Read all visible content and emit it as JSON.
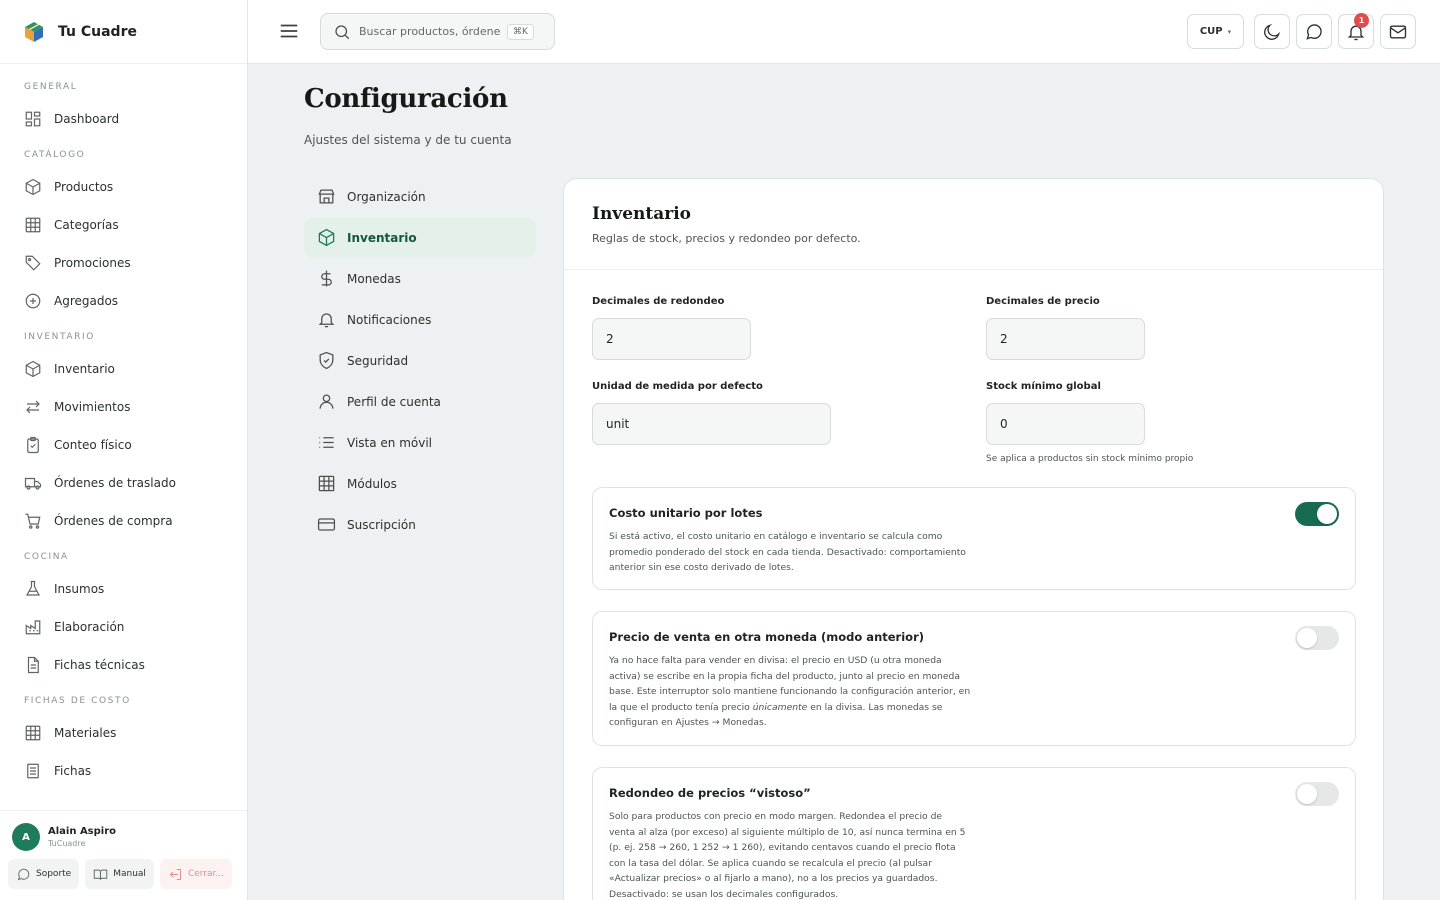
{
  "app": {
    "name": "Tu Cuadre"
  },
  "colors": {
    "accent": "#176b50",
    "active_bg": "#e4f0ea",
    "badge": "#e24b4b"
  },
  "sidebar": {
    "sections": [
      {
        "label": "GENERAL",
        "items": [
          {
            "label": "Dashboard",
            "icon": "dashboard-icon"
          }
        ]
      },
      {
        "label": "CATÁLOGO",
        "items": [
          {
            "label": "Productos",
            "icon": "box-icon"
          },
          {
            "label": "Categorías",
            "icon": "grid-icon"
          },
          {
            "label": "Promociones",
            "icon": "tag-icon"
          },
          {
            "label": "Agregados",
            "icon": "plus-circle-icon"
          }
        ]
      },
      {
        "label": "INVENTARIO",
        "items": [
          {
            "label": "Inventario",
            "icon": "box-icon"
          },
          {
            "label": "Movimientos",
            "icon": "arrows-icon"
          },
          {
            "label": "Conteo físico",
            "icon": "clipboard-icon"
          },
          {
            "label": "Órdenes de traslado",
            "icon": "truck-icon"
          },
          {
            "label": "Órdenes de compra",
            "icon": "cart-icon"
          }
        ]
      },
      {
        "label": "COCINA",
        "items": [
          {
            "label": "Insumos",
            "icon": "flask-icon"
          },
          {
            "label": "Elaboración",
            "icon": "factory-icon"
          },
          {
            "label": "Fichas técnicas",
            "icon": "file-icon"
          }
        ]
      },
      {
        "label": "FICHAS DE COSTO",
        "items": [
          {
            "label": "Materiales",
            "icon": "grid-icon"
          },
          {
            "label": "Fichas",
            "icon": "file-icon"
          }
        ]
      }
    ],
    "user": {
      "initial": "A",
      "name": "Alain Aspiro",
      "org": "TuCuadre"
    },
    "footer": {
      "support": "Soporte",
      "manual": "Manual",
      "logout": "Cerrar..."
    }
  },
  "topbar": {
    "search_placeholder": "Buscar productos, órdenes...",
    "search_shortcut": "⌘K",
    "currency": "CUP",
    "notifications_count": "1"
  },
  "page": {
    "title": "Configuración",
    "subtitle": "Ajustes del sistema y de tu cuenta"
  },
  "settings_nav": [
    {
      "label": "Organización",
      "icon": "store-icon",
      "active": false
    },
    {
      "label": "Inventario",
      "icon": "box-icon",
      "active": true
    },
    {
      "label": "Monedas",
      "icon": "dollar-icon",
      "active": false
    },
    {
      "label": "Notificaciones",
      "icon": "bell-icon",
      "active": false
    },
    {
      "label": "Seguridad",
      "icon": "shield-icon",
      "active": false
    },
    {
      "label": "Perfil de cuenta",
      "icon": "user-icon",
      "active": false
    },
    {
      "label": "Vista en móvil",
      "icon": "list-icon",
      "active": false
    },
    {
      "label": "Módulos",
      "icon": "grid-icon",
      "active": false
    },
    {
      "label": "Suscripción",
      "icon": "card-icon",
      "active": false
    }
  ],
  "panel": {
    "title": "Inventario",
    "description": "Reglas de stock, precios y redondeo por defecto.",
    "fields": {
      "rounding_decimals": {
        "label": "Decimales de redondeo",
        "value": "2"
      },
      "price_decimals": {
        "label": "Decimales de precio",
        "value": "2"
      },
      "default_unit": {
        "label": "Unidad de medida por defecto",
        "value": "unit"
      },
      "min_stock": {
        "label": "Stock mínimo global",
        "value": "0",
        "hint": "Se aplica a productos sin stock mínimo propio"
      }
    },
    "options": [
      {
        "title": "Costo unitario por lotes",
        "enabled": true,
        "desc": "Si está activo, el costo unitario en catálogo e inventario se calcula como promedio ponderado del stock en cada tienda. Desactivado: comportamiento anterior sin ese costo derivado de lotes."
      },
      {
        "title": "Precio de venta en otra moneda (modo anterior)",
        "enabled": false,
        "desc_pre": "Ya no hace falta para vender en divisa: el precio en USD (u otra moneda activa) se escribe en la propia ficha del producto, junto al precio en moneda base. Este interruptor solo mantiene funcionando la configuración anterior, en la que el producto tenía precio ",
        "desc_em": "únicamente",
        "desc_post": " en la divisa. Las monedas se configuran en Ajustes → Monedas."
      },
      {
        "title": "Redondeo de precios “vistoso”",
        "enabled": false,
        "desc": "Solo para productos con precio en modo margen. Redondea el precio de venta al alza (por exceso) al siguiente múltiplo de 10, así nunca termina en 5 (p. ej. 258 → 260, 1 252 → 1 260), evitando centavos cuando el precio flota con la tasa del dólar. Se aplica cuando se recalcula el precio (al pulsar «Actualizar precios» o al fijarlo a mano), no a los precios ya guardados. Desactivado: se usan los decimales configurados."
      }
    ]
  }
}
